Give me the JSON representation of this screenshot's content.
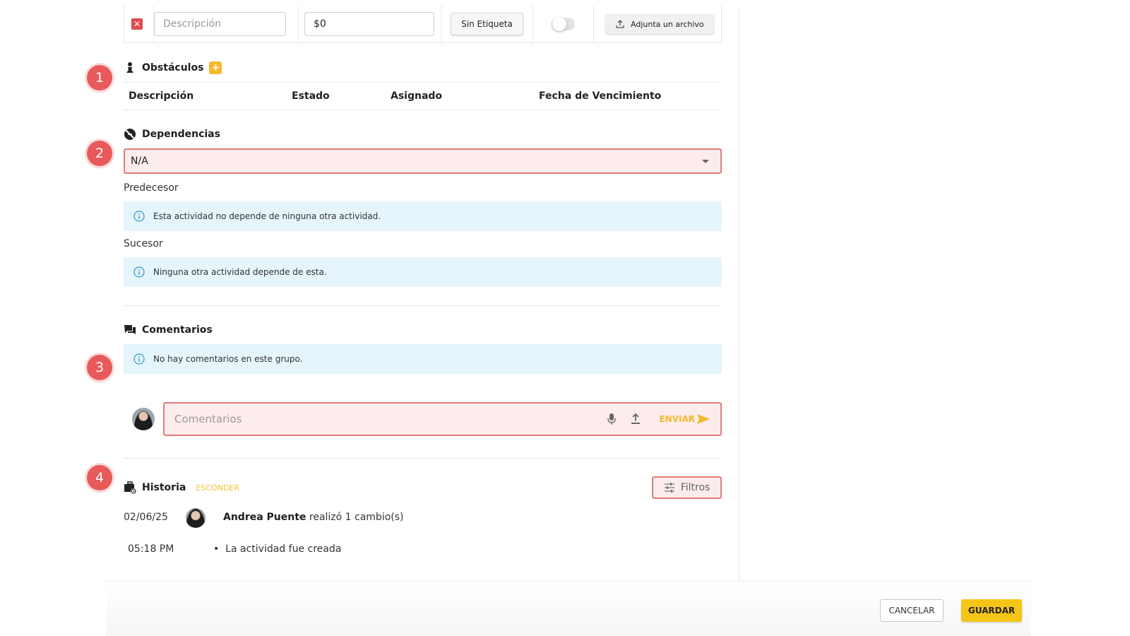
{
  "top_row": {
    "description_placeholder": "Descripción",
    "amount_value": "$0",
    "tag_label": "Sin Etiqueta",
    "attach_label": "Adjunta un archivo"
  },
  "badges": [
    "1",
    "2",
    "3",
    "4"
  ],
  "obstacles": {
    "title": "Obstáculos",
    "add_icon": "plus-icon",
    "columns": [
      "Descripción",
      "Estado",
      "Asignado",
      "Fecha de Vencimiento"
    ]
  },
  "dependencies": {
    "title": "Dependencias",
    "selected": "N/A",
    "predecessor_label": "Predecesor",
    "predecessor_info": "Esta actividad no depende de ninguna otra actividad.",
    "successor_label": "Sucesor",
    "successor_info": "Ninguna otra actividad depende de esta."
  },
  "comments": {
    "title": "Comentarios",
    "empty_info": "No hay comentarios en este grupo.",
    "input_placeholder": "Comentarios",
    "send_label": "ENVIAR"
  },
  "history": {
    "title": "Historia",
    "hide_label": "ESCONDER",
    "filter_label": "Filtros",
    "entries": [
      {
        "date": "02/06/25",
        "time": "05:18 PM",
        "user": "Andrea Puente",
        "action": "realizó 1 cambio(s)",
        "changes": [
          "La actividad fue creada"
        ]
      }
    ]
  },
  "footer": {
    "cancel_label": "CANCELAR",
    "save_label": "GUARDAR"
  },
  "colors": {
    "accent_yellow": "#f5c518",
    "badge_red": "#e85a5a",
    "error_border": "#e57a7a",
    "info_bg": "#e5f5fb"
  }
}
